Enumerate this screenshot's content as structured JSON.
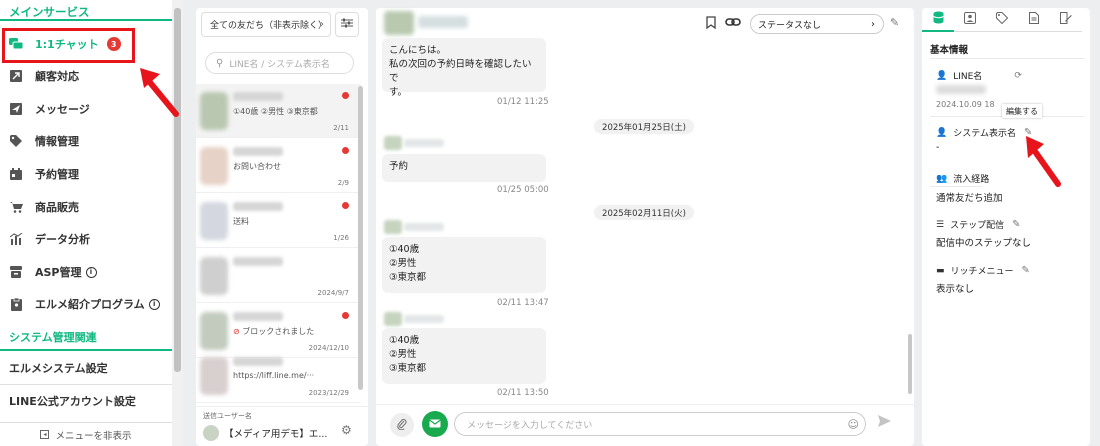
{
  "sidebar": {
    "header": "メインサービス",
    "items": [
      {
        "label": "1:1チャット",
        "icon": "chat-bubbles-icon",
        "badge": "3"
      },
      {
        "label": "顧客対応",
        "icon": "external-link-icon"
      },
      {
        "label": "メッセージ",
        "icon": "paper-plane-icon"
      },
      {
        "label": "情報管理",
        "icon": "tag-icon"
      },
      {
        "label": "予約管理",
        "icon": "calendar-icon"
      },
      {
        "label": "商品販売",
        "icon": "cart-icon"
      },
      {
        "label": "データ分析",
        "icon": "chart-icon"
      },
      {
        "label": "ASP管理",
        "icon": "tray-icon"
      },
      {
        "label": "エルメ紹介プログラム",
        "icon": "clipboard-icon"
      }
    ],
    "section2": "システム管理関連",
    "plain_items": [
      "エルメシステム設定",
      "LINE公式アカウント設定"
    ],
    "footer": "メニューを非表示"
  },
  "friends": {
    "filter": "全ての友だち（非表示除く）",
    "search_placeholder": "LINE名 / システム表示名",
    "rows": [
      {
        "msg": "①40歳 ②男性 ③東京都",
        "date": "2/11",
        "unread": true
      },
      {
        "msg": "お問い合わせ",
        "date": "2/9",
        "unread": true
      },
      {
        "msg": "送料",
        "date": "1/26",
        "unread": true
      },
      {
        "msg": "",
        "date": "2024/9/7",
        "unread": false
      },
      {
        "msg": "ブロックされました",
        "date": "2024/12/10",
        "unread": true
      },
      {
        "msg": "https://liff.line.me/···",
        "date": "2023/12/29",
        "unread": false
      }
    ],
    "sender_label": "送信ユーザー名",
    "sender_name": "【メディア用デモ】エ..."
  },
  "chat": {
    "status": "ステータスなし",
    "messages": {
      "m1_line1": "こんにちは。",
      "m1_line2": "私の次回の予約日時を確認したいで",
      "m1_line3": "す。",
      "m1_time": "01/12 11:25",
      "date1": "2025年01月25日(土)",
      "m2": "予約",
      "m2_time": "01/25 05:00",
      "date2": "2025年02月11日(火)",
      "m3_l1": "①40歳",
      "m3_l2": "②男性",
      "m3_l3": "③東京都",
      "m3_time": "02/11 13:47",
      "m4_l1": "①40歳",
      "m4_l2": "②男性",
      "m4_l3": "③東京都",
      "m4_time": "02/11 13:50"
    },
    "input_placeholder": "メッセージを入力してください"
  },
  "panel": {
    "title": "基本情報",
    "line_name_label": "LINE名",
    "line_name_date": "2024.10.09 18",
    "tooltip": "編集する",
    "system_name_label": "システム表示名",
    "system_name_value": "-",
    "route_label": "流入経路",
    "route_value": "通常友だち追加",
    "step_label": "ステップ配信",
    "step_value": "配信中のステップなし",
    "rich_label": "リッチメニュー",
    "rich_value": "表示なし"
  },
  "colors": {
    "accent": "#10b981",
    "alert": "#e53935",
    "highlight": "#e8141b"
  }
}
